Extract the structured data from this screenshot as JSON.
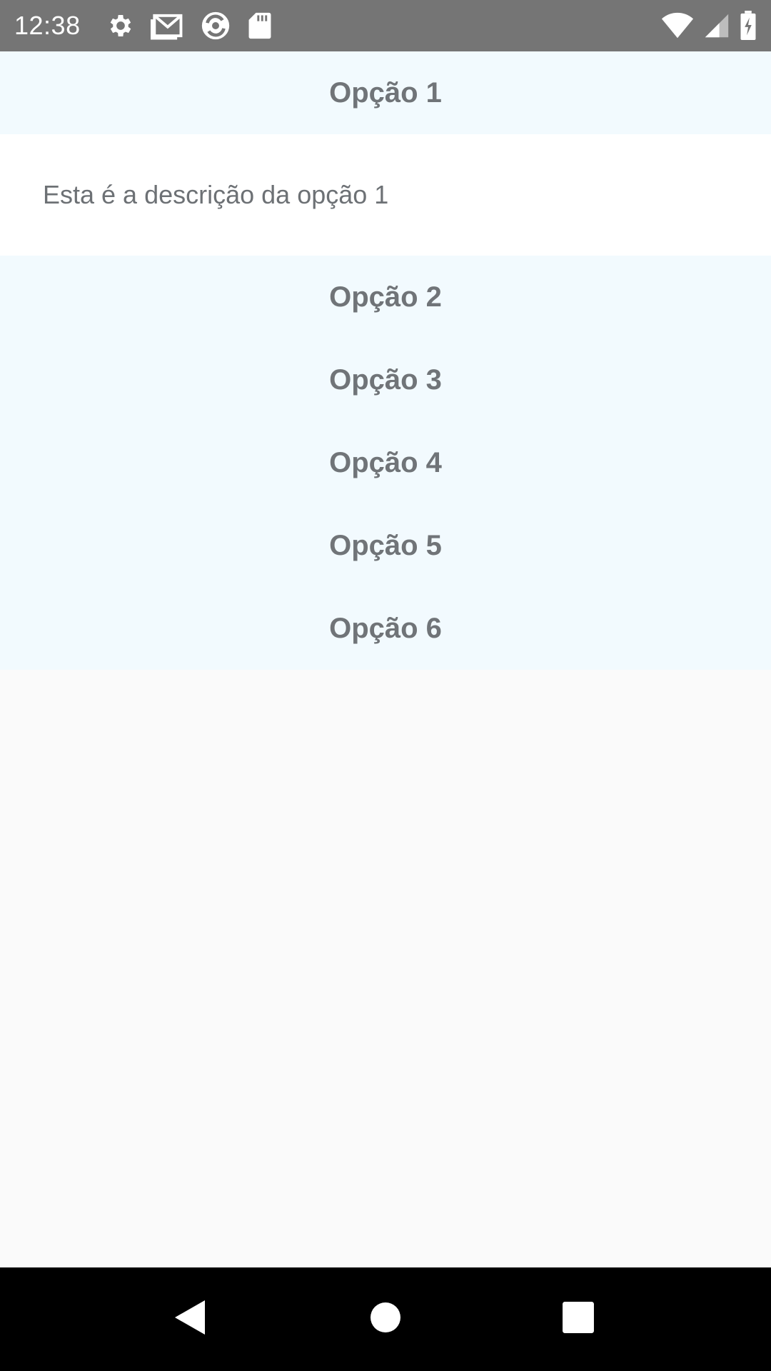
{
  "status_bar": {
    "time": "12:38",
    "left_icons": [
      "settings-icon",
      "gmail-icon",
      "sync-app-icon",
      "sd-card-icon"
    ],
    "right_icons": [
      "wifi-icon",
      "cell-signal-icon",
      "battery-charging-icon"
    ]
  },
  "accordion": {
    "items": [
      {
        "label": "Opção 1",
        "expanded": true,
        "description": "Esta é a descrição da opção 1"
      },
      {
        "label": "Opção 2",
        "expanded": false
      },
      {
        "label": "Opção 3",
        "expanded": false
      },
      {
        "label": "Opção 4",
        "expanded": false
      },
      {
        "label": "Opção 5",
        "expanded": false
      },
      {
        "label": "Opção 6",
        "expanded": false
      }
    ]
  },
  "colors": {
    "status_bar": "#757575",
    "header_bg": "#f2fafe",
    "panel_bg": "#ffffff",
    "text": "#707478",
    "page_bg": "#fafafa",
    "nav_bar": "#000000"
  },
  "nav_bar": {
    "buttons": [
      "back-icon",
      "home-icon",
      "recents-icon"
    ]
  }
}
